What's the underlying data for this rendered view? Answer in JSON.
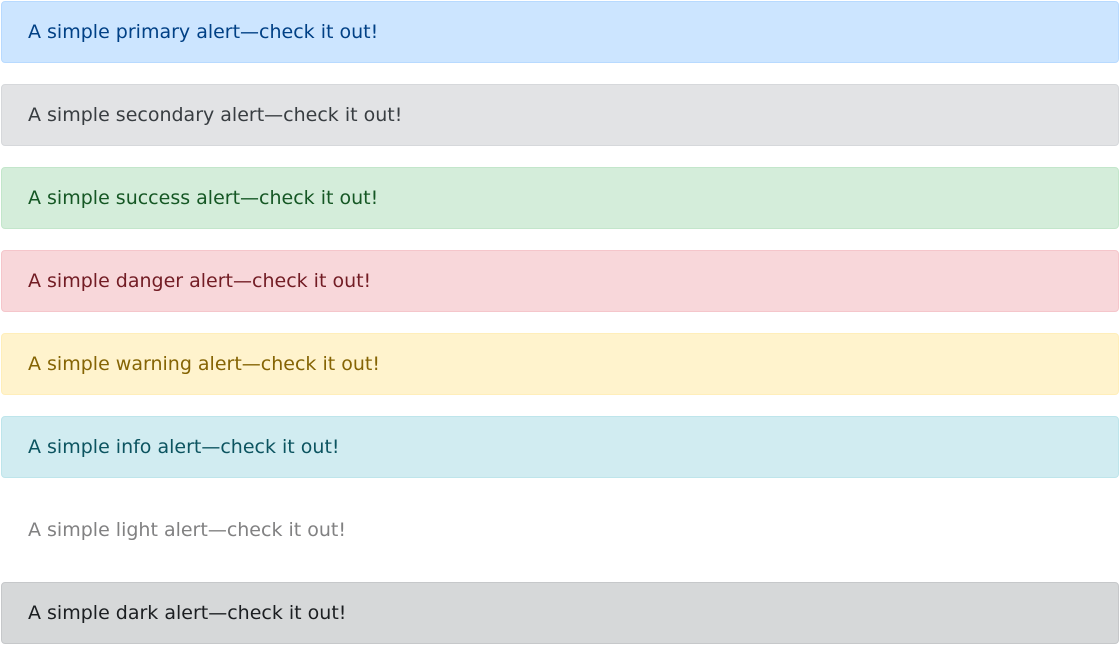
{
  "alerts": [
    {
      "variant": "primary",
      "text": "A simple primary alert—check it out!"
    },
    {
      "variant": "secondary",
      "text": "A simple secondary alert—check it out!"
    },
    {
      "variant": "success",
      "text": "A simple success alert—check it out!"
    },
    {
      "variant": "danger",
      "text": "A simple danger alert—check it out!"
    },
    {
      "variant": "warning",
      "text": "A simple warning alert—check it out!"
    },
    {
      "variant": "info",
      "text": "A simple info alert—check it out!"
    },
    {
      "variant": "light",
      "text": "A simple light alert—check it out!"
    },
    {
      "variant": "dark",
      "text": "A simple dark alert—check it out!"
    }
  ],
  "colors": {
    "primary_bg": "#cce5ff",
    "secondary_bg": "#e2e3e5",
    "success_bg": "#d4edda",
    "danger_bg": "#f8d7da",
    "warning_bg": "#fff3cd",
    "info_bg": "#d1ecf1",
    "light_bg": "#ffffff",
    "dark_bg": "#d6d8d9"
  }
}
